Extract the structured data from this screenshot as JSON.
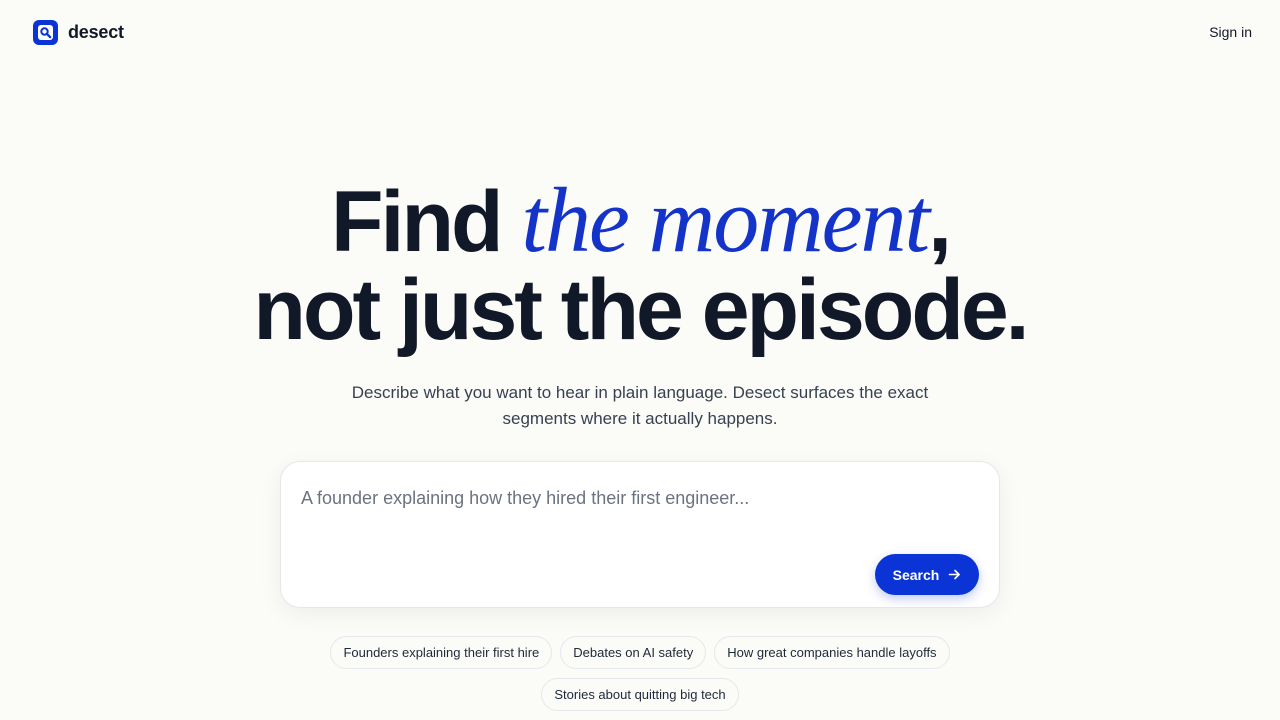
{
  "header": {
    "brand_name": "desect",
    "logo_icon": "search-document-icon",
    "signin_label": "Sign in"
  },
  "hero": {
    "headline_lead": "Find ",
    "headline_accent": "the moment",
    "headline_comma": ",",
    "headline_line2": "not just the episode.",
    "subtitle_line1": "Describe what you want to hear in plain language. Desect surfaces the exact",
    "subtitle_line2": "segments where it actually happens."
  },
  "search": {
    "placeholder": "A founder explaining how they hired their first engineer...",
    "value": "",
    "button_label": "Search",
    "button_icon": "arrow-right-icon"
  },
  "suggestions": [
    "Founders explaining their first hire",
    "Debates on AI safety",
    "How great companies handle layoffs",
    "Stories about quitting big tech"
  ],
  "colors": {
    "accent": "#1433c9",
    "button": "#0b34d6",
    "background": "#fbfbf8",
    "text": "#111827"
  }
}
